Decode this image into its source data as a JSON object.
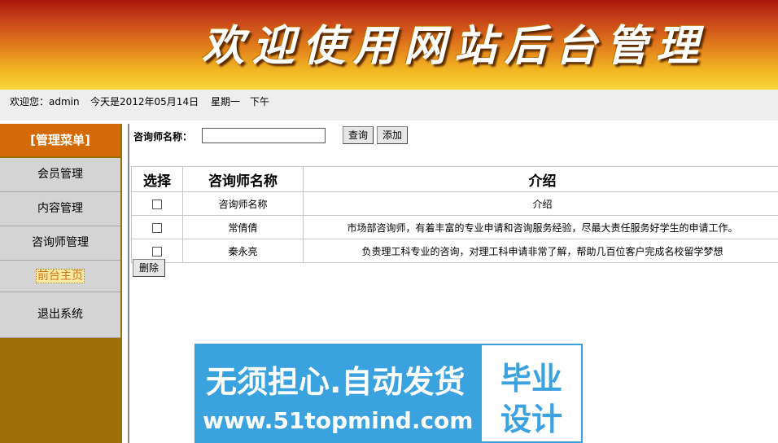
{
  "banner": {
    "title": "欢迎使用网站后台管理"
  },
  "info": {
    "welcome": "欢迎您：admin",
    "date": "今天是2012年05月14日",
    "weekday": "星期一",
    "period": "下午"
  },
  "sidebar": {
    "header": "[管理菜单]",
    "items": [
      {
        "label": "会员管理"
      },
      {
        "label": "内容管理"
      },
      {
        "label": "咨询师管理"
      },
      {
        "label": "前台主页"
      },
      {
        "label": "退出系统"
      }
    ]
  },
  "search": {
    "label": "咨询师名称：",
    "value": "",
    "query_button": "查询",
    "add_button": "添加"
  },
  "table": {
    "headers": [
      "选择",
      "咨询师名称",
      "介绍"
    ],
    "rows": [
      {
        "name": "咨询师名称",
        "intro": "介绍"
      },
      {
        "name": "常倩倩",
        "intro": "市场部咨询师，有着丰富的专业申请和咨询服务经验，尽最大责任服务好学生的申请工作。"
      },
      {
        "name": "秦永亮",
        "intro": "负责理工科专业的咨询，对理工科申请非常了解，帮助几百位客户完成名校留学梦想"
      }
    ]
  },
  "delete_button": "删除",
  "ad": {
    "line1": "无须担心.自动发货",
    "line2": "www.51topmind.com",
    "box_line1": "毕业",
    "box_line2": "设计"
  }
}
